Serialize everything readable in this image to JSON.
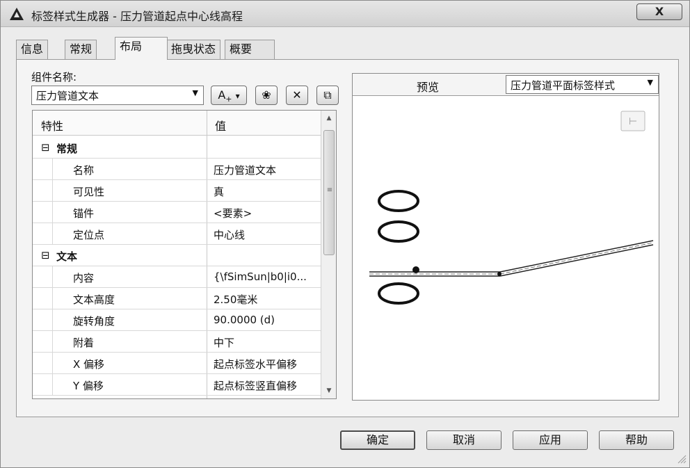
{
  "window": {
    "title": "标签样式生成器 - 压力管道起点中心线高程",
    "close": "X"
  },
  "tabs": [
    {
      "label": "信息"
    },
    {
      "label": "常规"
    },
    {
      "label": "布局"
    },
    {
      "label": "拖曳状态"
    },
    {
      "label": "概要"
    }
  ],
  "component": {
    "label": "组件名称:",
    "value": "压力管道文本"
  },
  "toolbar": {
    "text_component": "A",
    "text_sub": "+",
    "dropdown": "▾",
    "copy": "❀",
    "delete": "✕",
    "compose": "⧉"
  },
  "grid": {
    "header_property": "特性",
    "header_value": "值",
    "groups": [
      {
        "toggle": "⊟",
        "label": "常规"
      },
      {
        "toggle": "⊟",
        "label": "文本"
      }
    ],
    "rows": [
      {
        "name": "名称",
        "value": "压力管道文本"
      },
      {
        "name": "可见性",
        "value": "真"
      },
      {
        "name": "锚件",
        "value": "<要素>"
      },
      {
        "name": "定位点",
        "value": "中心线"
      },
      {
        "name": "内容",
        "value": "{\\fSimSun|b0|i0..."
      },
      {
        "name": "文本高度",
        "value": "2.50毫米"
      },
      {
        "name": "旋转角度",
        "value": "90.0000 (d)"
      },
      {
        "name": "附着",
        "value": "中下"
      },
      {
        "name": "X 偏移",
        "value": "起点标签水平偏移"
      },
      {
        "name": "Y 偏移",
        "value": "起点标签竖直偏移"
      }
    ],
    "scroll_grip": "≡"
  },
  "preview": {
    "label": "预览",
    "style_value": "压力管道平面标签样式",
    "corner_button": "⊢"
  },
  "buttons": {
    "ok": "确定",
    "cancel": "取消",
    "apply": "应用",
    "help": "帮助"
  },
  "colors": {
    "window_bg": "#ececec",
    "panel_bg": "#f4f4f4",
    "border": "#8a8a8a"
  }
}
